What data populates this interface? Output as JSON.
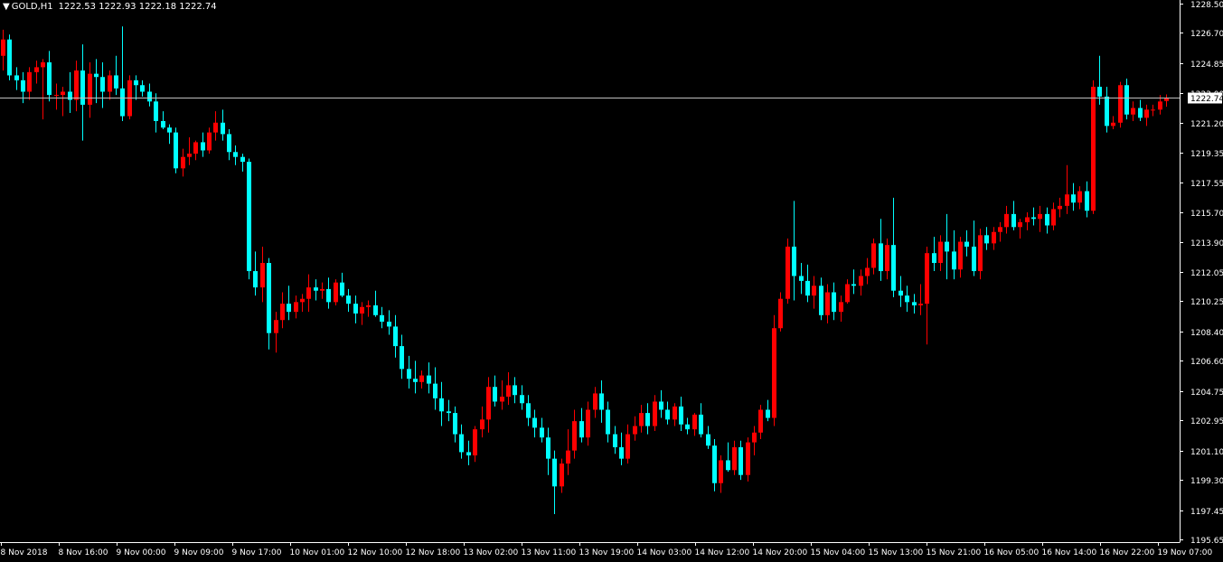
{
  "header": {
    "symbol": "GOLD,H1",
    "ohlc": "1222.53 1222.93 1222.18 1222.74",
    "menu_icon": "triangle-down-icon"
  },
  "chart_data": {
    "type": "candlestick",
    "symbol": "GOLD",
    "timeframe": "H1",
    "ylim": [
      1195.65,
      1228.5
    ],
    "y_ticks": [
      "1228.50",
      "1226.70",
      "1224.85",
      "1223.00",
      "1221.20",
      "1219.35",
      "1217.55",
      "1215.70",
      "1213.90",
      "1212.05",
      "1210.25",
      "1208.40",
      "1206.60",
      "1204.75",
      "1202.95",
      "1201.10",
      "1199.30",
      "1197.45",
      "1195.65"
    ],
    "x_ticks": [
      "8 Nov 2018",
      "8 Nov 16:00",
      "9 Nov 00:00",
      "9 Nov 09:00",
      "9 Nov 17:00",
      "10 Nov 01:00",
      "12 Nov 10:00",
      "12 Nov 18:00",
      "13 Nov 02:00",
      "13 Nov 11:00",
      "13 Nov 19:00",
      "14 Nov 03:00",
      "14 Nov 12:00",
      "14 Nov 20:00",
      "15 Nov 04:00",
      "15 Nov 13:00",
      "15 Nov 21:00",
      "16 Nov 05:00",
      "16 Nov 14:00",
      "16 Nov 22:00",
      "19 Nov 07:00"
    ],
    "current_price": "1222.74",
    "colors": {
      "up": "#ff0000",
      "down": "#00ffff",
      "price_line": "#c0c0c0",
      "axis": "#ffffff",
      "background": "#000000",
      "price_label_bg": "#ffffff",
      "price_label_text": "#000000"
    },
    "candles": [
      [
        1225.3,
        1226.9,
        1224.4,
        1226.3
      ],
      [
        1226.3,
        1226.6,
        1223.8,
        1224.1
      ],
      [
        1224.1,
        1224.6,
        1223.2,
        1223.8
      ],
      [
        1223.8,
        1224.3,
        1222.4,
        1223.1
      ],
      [
        1223.1,
        1224.6,
        1222.6,
        1224.3
      ],
      [
        1224.3,
        1225.0,
        1223.6,
        1224.6
      ],
      [
        1224.6,
        1225.1,
        1221.4,
        1224.9
      ],
      [
        1224.9,
        1225.6,
        1222.5,
        1222.9
      ],
      [
        1222.9,
        1223.6,
        1222.0,
        1222.9
      ],
      [
        1222.9,
        1223.4,
        1221.6,
        1223.1
      ],
      [
        1223.1,
        1224.3,
        1221.8,
        1222.6
      ],
      [
        1222.6,
        1225.0,
        1221.9,
        1224.4
      ],
      [
        1224.4,
        1226.0,
        1220.1,
        1222.3
      ],
      [
        1222.3,
        1224.9,
        1221.5,
        1224.2
      ],
      [
        1224.2,
        1225.1,
        1222.4,
        1224.0
      ],
      [
        1224.0,
        1224.9,
        1222.1,
        1223.1
      ],
      [
        1223.1,
        1224.4,
        1222.6,
        1224.1
      ],
      [
        1224.1,
        1225.3,
        1222.9,
        1223.3
      ],
      [
        1223.3,
        1227.1,
        1221.3,
        1221.6
      ],
      [
        1221.6,
        1224.1,
        1221.4,
        1223.8
      ],
      [
        1223.8,
        1224.1,
        1222.6,
        1223.5
      ],
      [
        1223.5,
        1223.8,
        1222.8,
        1223.1
      ],
      [
        1223.1,
        1223.6,
        1222.2,
        1222.5
      ],
      [
        1222.5,
        1223.0,
        1220.6,
        1221.3
      ],
      [
        1221.3,
        1221.9,
        1220.8,
        1220.9
      ],
      [
        1220.9,
        1221.1,
        1219.9,
        1220.6
      ],
      [
        1220.6,
        1220.9,
        1218.1,
        1218.4
      ],
      [
        1218.4,
        1219.6,
        1217.9,
        1219.1
      ],
      [
        1219.1,
        1220.3,
        1218.6,
        1219.3
      ],
      [
        1219.3,
        1220.1,
        1218.9,
        1220.0
      ],
      [
        1220.0,
        1220.6,
        1219.1,
        1219.5
      ],
      [
        1219.5,
        1220.9,
        1219.3,
        1220.6
      ],
      [
        1220.6,
        1221.9,
        1220.1,
        1221.2
      ],
      [
        1221.2,
        1222.0,
        1220.1,
        1220.5
      ],
      [
        1220.5,
        1220.8,
        1218.9,
        1219.4
      ],
      [
        1219.4,
        1219.8,
        1218.6,
        1219.1
      ],
      [
        1219.1,
        1219.3,
        1218.2,
        1218.8
      ],
      [
        1218.8,
        1219.0,
        1211.6,
        1212.1
      ],
      [
        1212.1,
        1213.3,
        1210.6,
        1211.1
      ],
      [
        1211.1,
        1213.6,
        1210.2,
        1212.6
      ],
      [
        1212.6,
        1212.9,
        1207.3,
        1208.3
      ],
      [
        1208.3,
        1209.6,
        1207.1,
        1209.1
      ],
      [
        1209.1,
        1210.8,
        1208.6,
        1210.1
      ],
      [
        1210.1,
        1211.2,
        1209.1,
        1209.6
      ],
      [
        1209.6,
        1210.6,
        1209.2,
        1210.2
      ],
      [
        1210.2,
        1210.7,
        1209.6,
        1210.4
      ],
      [
        1210.4,
        1211.9,
        1209.6,
        1211.1
      ],
      [
        1211.1,
        1211.6,
        1210.3,
        1210.9
      ],
      [
        1210.9,
        1211.4,
        1210.4,
        1211.0
      ],
      [
        1211.0,
        1211.7,
        1209.8,
        1210.2
      ],
      [
        1210.2,
        1211.6,
        1210.0,
        1211.4
      ],
      [
        1211.4,
        1212.0,
        1210.5,
        1210.6
      ],
      [
        1210.6,
        1211.0,
        1209.6,
        1210.1
      ],
      [
        1210.1,
        1210.6,
        1208.9,
        1209.5
      ],
      [
        1209.5,
        1210.2,
        1208.8,
        1209.9
      ],
      [
        1209.9,
        1210.3,
        1209.3,
        1210.0
      ],
      [
        1210.0,
        1210.9,
        1209.3,
        1209.4
      ],
      [
        1209.4,
        1209.9,
        1208.6,
        1209.0
      ],
      [
        1209.0,
        1209.7,
        1208.2,
        1208.7
      ],
      [
        1208.7,
        1209.4,
        1206.8,
        1207.5
      ],
      [
        1207.5,
        1208.2,
        1205.5,
        1206.1
      ],
      [
        1206.1,
        1206.9,
        1204.9,
        1205.5
      ],
      [
        1205.5,
        1206.6,
        1204.6,
        1205.3
      ],
      [
        1205.3,
        1206.0,
        1204.9,
        1205.7
      ],
      [
        1205.7,
        1206.5,
        1204.6,
        1205.2
      ],
      [
        1205.2,
        1206.2,
        1203.6,
        1204.3
      ],
      [
        1204.3,
        1205.3,
        1202.6,
        1203.5
      ],
      [
        1203.5,
        1204.2,
        1202.9,
        1203.4
      ],
      [
        1203.4,
        1203.8,
        1201.6,
        1202.1
      ],
      [
        1202.1,
        1202.7,
        1200.6,
        1201.0
      ],
      [
        1201.0,
        1201.7,
        1200.2,
        1200.8
      ],
      [
        1200.8,
        1202.6,
        1200.4,
        1202.4
      ],
      [
        1202.4,
        1203.8,
        1201.9,
        1203.0
      ],
      [
        1203.0,
        1205.6,
        1202.2,
        1205.0
      ],
      [
        1205.0,
        1205.7,
        1203.8,
        1204.1
      ],
      [
        1204.1,
        1205.4,
        1203.6,
        1204.4
      ],
      [
        1204.4,
        1205.9,
        1203.9,
        1205.1
      ],
      [
        1205.1,
        1205.6,
        1204.0,
        1204.5
      ],
      [
        1204.5,
        1205.1,
        1203.6,
        1204.0
      ],
      [
        1204.0,
        1204.5,
        1202.6,
        1203.1
      ],
      [
        1203.1,
        1203.6,
        1201.9,
        1202.5
      ],
      [
        1202.5,
        1203.1,
        1201.6,
        1201.9
      ],
      [
        1201.9,
        1202.5,
        1199.6,
        1200.6
      ],
      [
        1200.6,
        1201.1,
        1197.2,
        1198.9
      ],
      [
        1198.9,
        1200.6,
        1198.5,
        1200.3
      ],
      [
        1200.3,
        1202.4,
        1199.6,
        1201.1
      ],
      [
        1201.1,
        1203.6,
        1200.6,
        1202.9
      ],
      [
        1202.9,
        1203.7,
        1201.6,
        1201.9
      ],
      [
        1201.9,
        1204.1,
        1201.4,
        1203.6
      ],
      [
        1203.6,
        1205.0,
        1203.1,
        1204.6
      ],
      [
        1204.6,
        1205.4,
        1202.8,
        1203.6
      ],
      [
        1203.6,
        1204.1,
        1201.6,
        1202.1
      ],
      [
        1202.1,
        1202.6,
        1200.9,
        1201.3
      ],
      [
        1201.3,
        1202.2,
        1200.2,
        1200.6
      ],
      [
        1200.6,
        1202.7,
        1200.3,
        1202.1
      ],
      [
        1202.1,
        1203.2,
        1201.7,
        1202.6
      ],
      [
        1202.6,
        1203.9,
        1202.2,
        1203.4
      ],
      [
        1203.4,
        1204.0,
        1202.1,
        1202.6
      ],
      [
        1202.6,
        1204.5,
        1202.3,
        1204.1
      ],
      [
        1204.1,
        1204.8,
        1203.1,
        1203.6
      ],
      [
        1203.6,
        1204.1,
        1202.7,
        1203.0
      ],
      [
        1203.0,
        1204.0,
        1202.6,
        1203.8
      ],
      [
        1203.8,
        1204.4,
        1202.3,
        1202.7
      ],
      [
        1202.7,
        1203.1,
        1202.1,
        1202.4
      ],
      [
        1202.4,
        1203.4,
        1202.0,
        1203.3
      ],
      [
        1203.3,
        1204.0,
        1201.9,
        1202.1
      ],
      [
        1202.1,
        1202.6,
        1201.2,
        1201.4
      ],
      [
        1201.4,
        1201.8,
        1198.6,
        1199.1
      ],
      [
        1199.1,
        1200.8,
        1198.5,
        1200.5
      ],
      [
        1200.5,
        1201.6,
        1199.8,
        1199.9
      ],
      [
        1199.9,
        1201.7,
        1199.6,
        1201.3
      ],
      [
        1201.3,
        1201.7,
        1199.3,
        1199.6
      ],
      [
        1199.6,
        1201.9,
        1199.2,
        1201.6
      ],
      [
        1201.6,
        1202.6,
        1200.8,
        1202.2
      ],
      [
        1202.2,
        1203.9,
        1201.8,
        1203.6
      ],
      [
        1203.6,
        1204.2,
        1202.9,
        1203.1
      ],
      [
        1203.1,
        1209.4,
        1202.6,
        1208.6
      ],
      [
        1208.6,
        1210.8,
        1208.4,
        1210.4
      ],
      [
        1210.4,
        1214.1,
        1210.1,
        1213.6
      ],
      [
        1213.6,
        1216.4,
        1210.3,
        1211.8
      ],
      [
        1211.8,
        1212.6,
        1210.7,
        1211.5
      ],
      [
        1211.5,
        1212.5,
        1210.2,
        1210.6
      ],
      [
        1210.6,
        1211.8,
        1209.8,
        1211.2
      ],
      [
        1211.2,
        1211.7,
        1209.1,
        1209.4
      ],
      [
        1209.4,
        1211.3,
        1208.9,
        1210.8
      ],
      [
        1210.8,
        1211.4,
        1209.1,
        1209.6
      ],
      [
        1209.6,
        1210.6,
        1209.0,
        1210.2
      ],
      [
        1210.2,
        1211.6,
        1210.1,
        1211.3
      ],
      [
        1211.3,
        1212.2,
        1210.7,
        1211.2
      ],
      [
        1211.2,
        1212.2,
        1210.6,
        1211.8
      ],
      [
        1211.8,
        1212.9,
        1211.3,
        1212.3
      ],
      [
        1212.3,
        1214.1,
        1211.9,
        1213.8
      ],
      [
        1213.8,
        1215.3,
        1211.5,
        1212.1
      ],
      [
        1212.1,
        1214.1,
        1211.6,
        1213.7
      ],
      [
        1213.7,
        1216.6,
        1210.5,
        1210.9
      ],
      [
        1210.9,
        1211.8,
        1209.9,
        1210.6
      ],
      [
        1210.6,
        1211.2,
        1209.6,
        1210.2
      ],
      [
        1210.2,
        1210.7,
        1209.5,
        1210.0
      ],
      [
        1210.0,
        1211.3,
        1209.4,
        1210.1
      ],
      [
        1210.1,
        1213.6,
        1207.6,
        1213.2
      ],
      [
        1213.2,
        1214.2,
        1212.1,
        1212.6
      ],
      [
        1212.6,
        1214.3,
        1212.1,
        1213.9
      ],
      [
        1213.9,
        1215.6,
        1211.6,
        1213.3
      ],
      [
        1213.3,
        1214.6,
        1211.6,
        1212.2
      ],
      [
        1212.2,
        1214.2,
        1211.7,
        1213.9
      ],
      [
        1213.9,
        1214.6,
        1213.0,
        1213.6
      ],
      [
        1213.6,
        1215.2,
        1211.8,
        1212.1
      ],
      [
        1212.1,
        1214.7,
        1211.6,
        1214.3
      ],
      [
        1214.3,
        1214.8,
        1213.4,
        1213.8
      ],
      [
        1213.8,
        1214.8,
        1213.4,
        1214.5
      ],
      [
        1214.5,
        1215.1,
        1213.9,
        1214.8
      ],
      [
        1214.8,
        1216.1,
        1214.4,
        1215.6
      ],
      [
        1215.6,
        1216.4,
        1214.6,
        1214.8
      ],
      [
        1214.8,
        1215.3,
        1214.1,
        1215.1
      ],
      [
        1215.1,
        1215.7,
        1214.6,
        1215.4
      ],
      [
        1215.4,
        1216.0,
        1214.9,
        1215.3
      ],
      [
        1215.3,
        1216.1,
        1214.5,
        1215.6
      ],
      [
        1215.6,
        1216.0,
        1214.4,
        1214.9
      ],
      [
        1214.9,
        1216.3,
        1214.6,
        1215.9
      ],
      [
        1215.9,
        1216.6,
        1215.4,
        1216.1
      ],
      [
        1216.1,
        1218.6,
        1215.6,
        1216.8
      ],
      [
        1216.8,
        1217.5,
        1215.8,
        1216.3
      ],
      [
        1216.3,
        1217.3,
        1215.9,
        1217.0
      ],
      [
        1217.0,
        1217.6,
        1215.4,
        1215.8
      ],
      [
        1215.8,
        1223.8,
        1215.6,
        1223.4
      ],
      [
        1223.4,
        1225.3,
        1222.3,
        1222.8
      ],
      [
        1222.8,
        1223.4,
        1220.6,
        1221.0
      ],
      [
        1221.0,
        1221.6,
        1220.8,
        1221.2
      ],
      [
        1221.2,
        1223.7,
        1220.9,
        1223.5
      ],
      [
        1223.5,
        1223.9,
        1221.4,
        1221.7
      ],
      [
        1221.7,
        1222.5,
        1221.3,
        1222.1
      ],
      [
        1222.1,
        1222.6,
        1221.3,
        1221.5
      ],
      [
        1221.5,
        1222.3,
        1221.0,
        1222.0
      ],
      [
        1222.0,
        1222.3,
        1221.6,
        1222.0
      ],
      [
        1222.0,
        1222.9,
        1221.7,
        1222.5
      ],
      [
        1222.53,
        1222.93,
        1222.18,
        1222.74
      ]
    ]
  }
}
